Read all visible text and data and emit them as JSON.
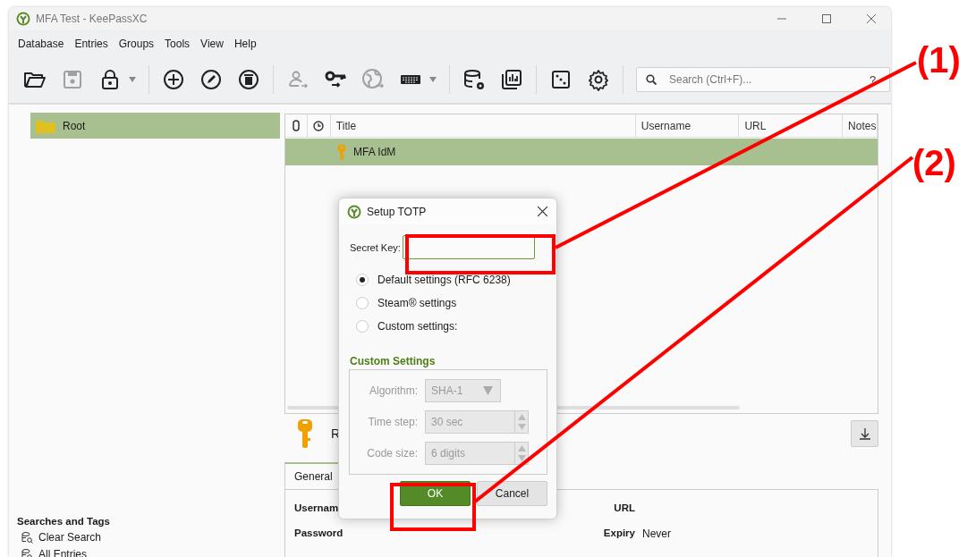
{
  "window": {
    "title": "MFA Test - KeePassXC"
  },
  "menu": [
    "Database",
    "Entries",
    "Groups",
    "Tools",
    "View",
    "Help"
  ],
  "toolbar": {
    "groups": [
      [
        {
          "disabled": false,
          "has_menu": false
        },
        {
          "disabled": true,
          "has_menu": false
        },
        {
          "disabled": false,
          "has_menu": true
        }
      ],
      [
        {
          "disabled": false,
          "has_menu": false
        },
        {
          "disabled": false,
          "has_menu": false
        },
        {
          "disabled": false,
          "has_menu": false
        }
      ],
      [
        {
          "disabled": true,
          "has_menu": false
        },
        {
          "disabled": false,
          "has_menu": false
        },
        {
          "disabled": true,
          "has_menu": false
        },
        {
          "disabled": false,
          "has_menu": true
        }
      ],
      [
        {
          "disabled": false,
          "has_menu": false
        },
        {
          "disabled": false,
          "has_menu": false
        }
      ],
      [
        {
          "disabled": false,
          "has_menu": false
        },
        {
          "disabled": false,
          "has_menu": false
        }
      ]
    ],
    "search": {
      "placeholder": "Search (Ctrl+F)...",
      "help": "?"
    }
  },
  "groups": [
    {
      "name": "Root",
      "selected": true
    }
  ],
  "searches": {
    "title": "Searches and Tags",
    "items": [
      "Clear Search",
      "All Entries"
    ]
  },
  "table": {
    "columns": [
      "Title",
      "Username",
      "URL",
      "Notes"
    ],
    "rows": [
      {
        "title": "MFA IdM",
        "selected": true
      }
    ]
  },
  "preview": {
    "title": "R",
    "tabs": [
      {
        "label": "General",
        "selected": true
      }
    ],
    "fields": [
      {
        "label": "Usernam"
      },
      {
        "label": "URL"
      },
      {
        "label": "Password"
      },
      {
        "label": "Expiry",
        "value": "Never"
      }
    ]
  },
  "dialog": {
    "title": "Setup TOTP",
    "secret_key": {
      "label": "Secret Key:",
      "focused": true
    },
    "options": [
      {
        "label": "Default settings (RFC 6238)",
        "selected": true
      },
      {
        "label": "Steam® settings",
        "selected": false
      },
      {
        "label": "Custom settings:",
        "selected": false
      }
    ],
    "custom": {
      "title": "Custom Settings",
      "disabled": true,
      "fields": [
        {
          "label": "Algorithm:",
          "value": "SHA-1",
          "kind": "dropdown"
        },
        {
          "label": "Time step:",
          "value": "30 sec",
          "kind": "spinner"
        },
        {
          "label": "Code size:",
          "value": "6 digits",
          "kind": "spinner"
        }
      ]
    },
    "buttons": [
      {
        "label": "OK",
        "default": true
      },
      {
        "label": "Cancel",
        "default": false
      }
    ]
  },
  "annotations": [
    {
      "label": "(1)"
    },
    {
      "label": "(2)"
    }
  ]
}
